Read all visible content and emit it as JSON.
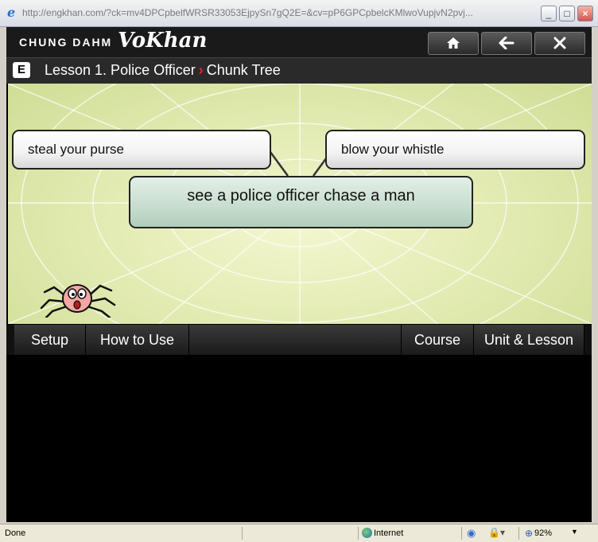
{
  "browser": {
    "url": "http://engkhan.com/?ck=mv4DPCpbelfWRSR33053EjpySn7gQ2E=&cv=pP6GPCpbelcKMlwoVupjvN2pvj...",
    "status_text": "Done",
    "zone_text": "Internet",
    "zoom_text": "92%"
  },
  "app": {
    "brand_text": "CHUNG DAHM",
    "brand_logo": "VoKhan"
  },
  "breadcrumb": {
    "badge": "E",
    "lesson": "Lesson 1. Police Officer",
    "separator": "›",
    "section": "Chunk Tree"
  },
  "chunks": {
    "left": "steal your purse",
    "right": "blow your whistle",
    "main": "see a police officer chase a man"
  },
  "nav": {
    "setup": "Setup",
    "how_to_use": "How to Use",
    "course": "Course",
    "unit_lesson": "Unit & Lesson"
  },
  "icons": {
    "home": "home-icon",
    "back": "back-arrow-icon",
    "close": "close-icon"
  },
  "colors": {
    "accent_red": "#e5262c",
    "stage_bg": "#e4ecb5",
    "main_chunk": "#c7ddcf"
  }
}
